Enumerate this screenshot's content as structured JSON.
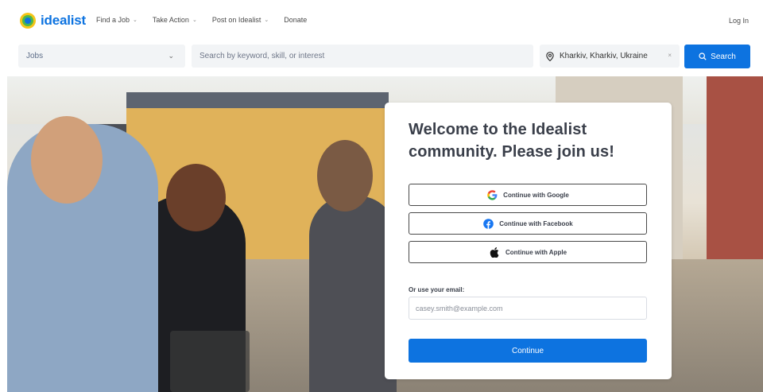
{
  "brand": {
    "name": "idealist",
    "primary_color": "#0d73e0"
  },
  "nav": {
    "items": [
      {
        "label": "Find a Job",
        "has_dropdown": true
      },
      {
        "label": "Take Action",
        "has_dropdown": true
      },
      {
        "label": "Post on Idealist",
        "has_dropdown": true
      },
      {
        "label": "Donate",
        "has_dropdown": false
      }
    ],
    "login_label": "Log In"
  },
  "search": {
    "type_value": "Jobs",
    "keyword_placeholder": "Search by keyword, skill, or interest",
    "location_value": "Kharkiv, Kharkiv, Ukraine",
    "clear_symbol": "×",
    "button_label": "Search"
  },
  "card": {
    "title": "Welcome to the Idealist community. Please join us!",
    "google_label": "Continue with Google",
    "facebook_label": "Continue with Facebook",
    "apple_label": "Continue with Apple",
    "email_label": "Or use your email:",
    "email_placeholder": "casey.smith@example.com",
    "continue_label": "Continue"
  },
  "icons": [
    "idealist-logo-icon",
    "chevron-down-icon",
    "location-pin-icon",
    "search-icon",
    "google-icon",
    "facebook-icon",
    "apple-icon"
  ]
}
